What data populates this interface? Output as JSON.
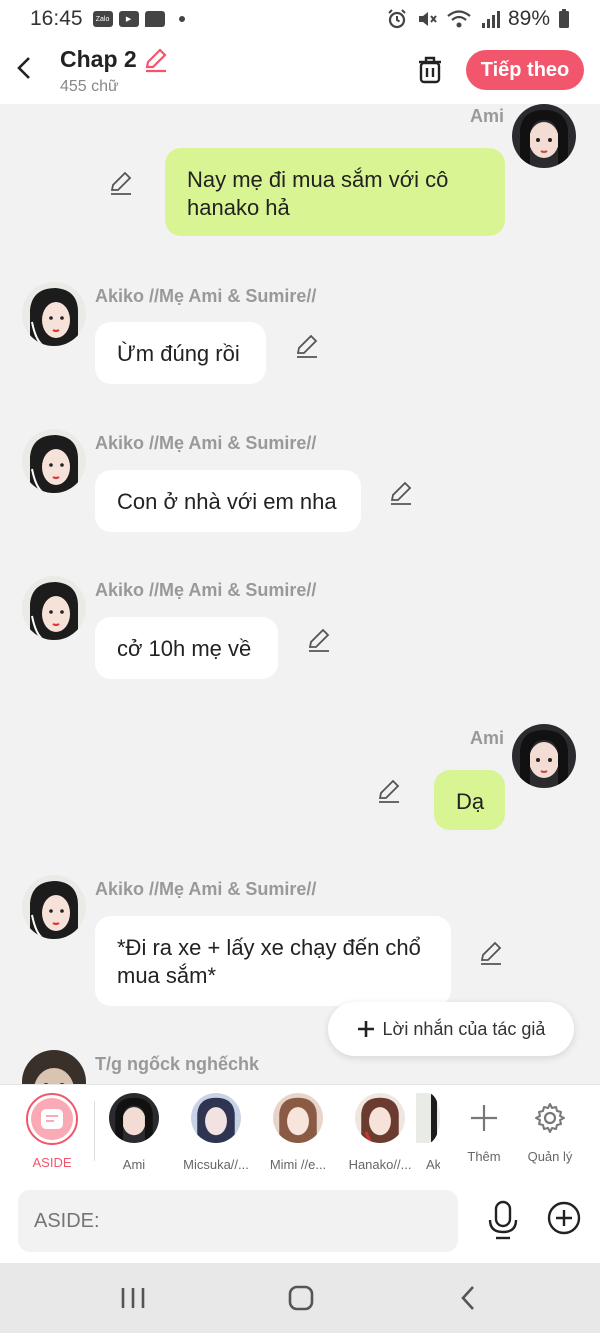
{
  "status": {
    "time": "16:45",
    "battery": "89%",
    "notif_zalo": "Zalo"
  },
  "header": {
    "title": "Chap 2",
    "subtitle": "455 chữ",
    "next_label": "Tiếp theo"
  },
  "messages": [
    {
      "sender": "Ami",
      "text": "Nay mẹ đi mua sắm với cô hanako hả"
    },
    {
      "sender": "Akiko //Mẹ Ami & Sumire//",
      "text": "Ừm đúng rồi"
    },
    {
      "sender": "Akiko //Mẹ Ami & Sumire//",
      "text": "Con ở nhà với em nha"
    },
    {
      "sender": "Akiko //Mẹ Ami & Sumire//",
      "text": "cở 10h mẹ về"
    },
    {
      "sender": "Ami",
      "text": "Dạ"
    },
    {
      "sender": "Akiko //Mẹ Ami & Sumire//",
      "text": "*Đi ra xe + lấy xe chạy đến chổ mua sắm*"
    },
    {
      "sender": "T/g ngốck nghếchk",
      "text": ""
    }
  ],
  "author_note_label": "Lời nhắn của tác giả",
  "characters": [
    {
      "name": "ASIDE"
    },
    {
      "name": "Ami"
    },
    {
      "name": "Micsuka//..."
    },
    {
      "name": "Mimi //e..."
    },
    {
      "name": "Hanako//..."
    },
    {
      "name": "Ak"
    },
    {
      "name": "Thêm"
    },
    {
      "name": "Quản lý"
    }
  ],
  "input": {
    "placeholder": "ASIDE:"
  },
  "colors": {
    "accent": "#f2566d",
    "me_bubble": "#d9f593",
    "other_bubble": "#ffffff",
    "background": "#f2f2f2"
  }
}
